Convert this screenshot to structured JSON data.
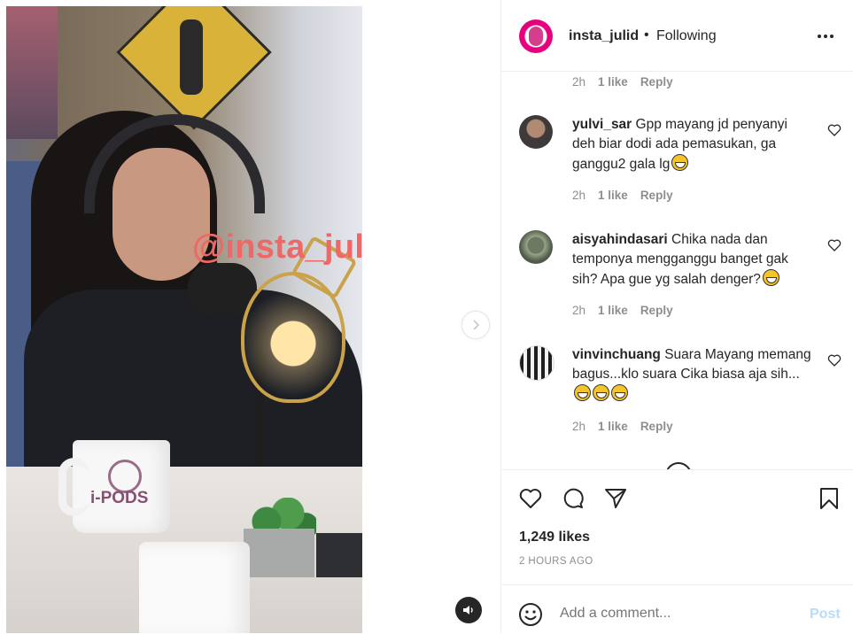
{
  "post": {
    "watermark": "@insta_julid",
    "mug_logo": "i-PODS"
  },
  "header": {
    "username": "insta_julid",
    "separator": "•",
    "follow_status": "Following"
  },
  "comments": [
    {
      "time": "2h",
      "likes": "1 like",
      "reply": "Reply"
    },
    {
      "username": "yulvi_sar",
      "text": "Gpp mayang jd penyanyi deh biar dodi ada pemasukan, ga ganggu2 gala lg",
      "emoji": "grinning-sweat",
      "time": "2h",
      "likes": "1 like",
      "reply": "Reply"
    },
    {
      "username": "aisyahindasari",
      "text": "Chika nada dan temponya mengganggu banget gak sih? Apa gue yg salah denger?",
      "emoji": "sweat-smile",
      "time": "2h",
      "likes": "1 like",
      "reply": "Reply"
    },
    {
      "username": "vinvinchuang",
      "text": "Suara Mayang memang bagus...klo suara Cika biasa aja sih...",
      "emoji": "joy x3",
      "time": "2h",
      "likes": "1 like",
      "reply": "Reply"
    }
  ],
  "actions": {
    "likes": "1,249 likes",
    "time": "2 HOURS AGO"
  },
  "add_comment": {
    "placeholder": "Add a comment...",
    "post_label": "Post"
  },
  "colors": {
    "post_button_disabled": "#b8dcf7",
    "watermark": "#ef6767",
    "muted": "#8e8e8e"
  }
}
